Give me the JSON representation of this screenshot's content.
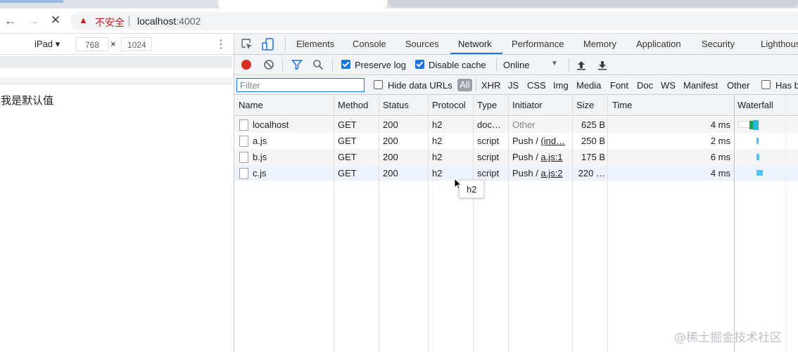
{
  "browser": {
    "back_glyph": "←",
    "forward_glyph": "→",
    "stop_glyph": "✕",
    "security_label": "不安全",
    "url_host": "localhost",
    "url_port": ":4002"
  },
  "device": {
    "name": "iPad ▾",
    "width": "768",
    "times": "×",
    "height": "1024",
    "more": "⋮",
    "page_text": "我是默认值"
  },
  "devtools": {
    "tabs": [
      "Elements",
      "Console",
      "Sources",
      "Network",
      "Performance",
      "Memory",
      "Application",
      "Security",
      "Lighthouse"
    ],
    "active_tab": "Network"
  },
  "network_toolbar": {
    "preserve_log": "Preserve log",
    "disable_cache": "Disable cache",
    "throttle": "Online",
    "throttle_caret": "▼"
  },
  "filter": {
    "placeholder": "Filter",
    "hide_data_urls": "Hide data URLs",
    "all": "All",
    "types": [
      "XHR",
      "JS",
      "CSS",
      "Img",
      "Media",
      "Font",
      "Doc",
      "WS",
      "Manifest",
      "Other"
    ],
    "has_blocked": "Has b"
  },
  "table": {
    "headers": [
      "Name",
      "Method",
      "Status",
      "Protocol",
      "Type",
      "Initiator",
      "Size",
      "Time",
      "Waterfall"
    ],
    "rows": [
      {
        "name": "localhost",
        "method": "GET",
        "status": "200",
        "protocol": "h2",
        "type": "doc…",
        "initiator_prefix": "",
        "initiator_link": "",
        "initiator_plain": "Other",
        "size": "625 B",
        "time": "4 ms"
      },
      {
        "name": "a.js",
        "method": "GET",
        "status": "200",
        "protocol": "h2",
        "type": "script",
        "initiator_prefix": "Push / ",
        "initiator_link": "(ind…",
        "initiator_plain": "",
        "size": "250 B",
        "time": "2 ms"
      },
      {
        "name": "b.js",
        "method": "GET",
        "status": "200",
        "protocol": "h2",
        "type": "script",
        "initiator_prefix": "Push / ",
        "initiator_link": "a.js:1",
        "initiator_plain": "",
        "size": "175 B",
        "time": "6 ms"
      },
      {
        "name": "c.js",
        "method": "GET",
        "status": "200",
        "protocol": "h2",
        "type": "script",
        "initiator_prefix": "Push / ",
        "initiator_link": "a.js:2",
        "initiator_plain": "",
        "size": "220 …",
        "time": "4 ms"
      }
    ]
  },
  "tooltip": "h2",
  "watermark": "@稀土掘金技术社区",
  "colors": {
    "accent": "#1a73e8",
    "record": "#d93025",
    "insecure": "#c5221f",
    "waterfall_green": "#1ea446",
    "waterfall_blue": "#4fc3f7"
  }
}
